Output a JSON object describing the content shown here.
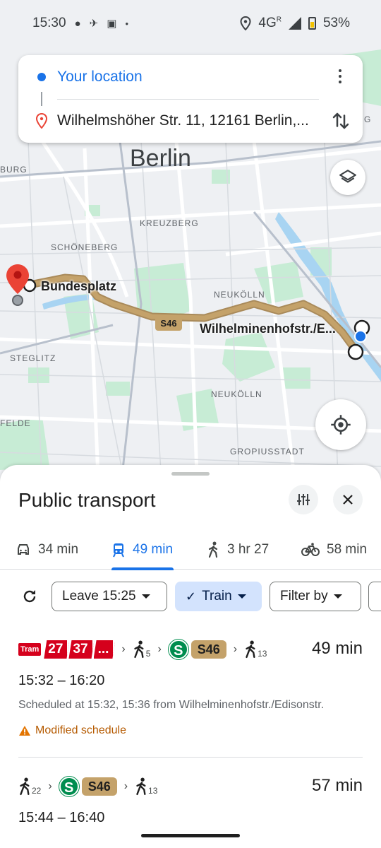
{
  "status_bar": {
    "time": "15:30",
    "left_icons": [
      "chat-bubble-icon",
      "airplane-icon",
      "card-icon",
      "dot-icon"
    ],
    "network": "4G",
    "network_sup": "R",
    "battery": "53%"
  },
  "search": {
    "origin": "Your location",
    "destination": "Wilhelmshöher Str. 11, 12161 Berlin,..."
  },
  "map": {
    "city": "Berlin",
    "district_labels": [
      "BURG",
      "KREUZBERG",
      "SCHÖNEBERG",
      "NEUKÖLLN",
      "STEGLITZ",
      "NEUKÖLLN",
      "FELDE",
      "GROPIUSSTADT",
      "G"
    ],
    "stops": {
      "start": "Bundesplatz",
      "end": "Wilhelminenhofstr./E..."
    },
    "line_label": "S46",
    "route_color": "#c4a26a",
    "water_color": "#a8d4f2",
    "park_color": "#c7ecd5"
  },
  "sheet": {
    "title": "Public transport",
    "modes": [
      {
        "icon": "car-icon",
        "label": "34 min"
      },
      {
        "icon": "train-icon",
        "label": "49 min",
        "active": true
      },
      {
        "icon": "walk-icon",
        "label": "3 hr 27"
      },
      {
        "icon": "bike-icon",
        "label": "58 min"
      }
    ],
    "filters": {
      "leave": "Leave 15:25",
      "train": "Train",
      "filter": "Filter by"
    },
    "trips": [
      {
        "tram_badge": "Tram",
        "tram_lines": [
          "27",
          "37",
          "..."
        ],
        "walk1": "5",
        "sbahn": "S",
        "line": "S46",
        "walk2": "13",
        "duration": "49 min",
        "times": "15:32 – 16:20",
        "scheduled": "Scheduled at 15:32, 15:36 from Wilhelminenhofstr./Edisonstr.",
        "warning": "Modified schedule"
      },
      {
        "walk1": "22",
        "sbahn": "S",
        "line": "S46",
        "walk2": "13",
        "duration": "57 min",
        "times": "15:44 – 16:40"
      }
    ]
  }
}
